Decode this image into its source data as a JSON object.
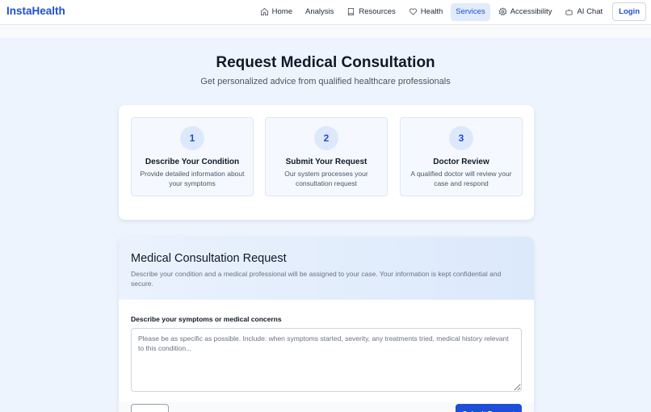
{
  "nav": {
    "brand": "InstaHealth",
    "items": [
      {
        "label": "Home",
        "icon": "home-icon"
      },
      {
        "label": "Analysis",
        "icon": ""
      },
      {
        "label": "Resources",
        "icon": "book-icon"
      },
      {
        "label": "Health",
        "icon": "heart-icon"
      },
      {
        "label": "Services",
        "icon": "",
        "active": true
      },
      {
        "label": "Accessibility",
        "icon": "settings-icon"
      },
      {
        "label": "AI Chat",
        "icon": "bot-icon"
      }
    ],
    "login": "Login"
  },
  "header": {
    "title": "Request Medical Consultation",
    "subtitle": "Get personalized advice from qualified healthcare professionals"
  },
  "steps": [
    {
      "number": "1",
      "title": "Describe Your Condition",
      "desc": "Provide detailed information about your symptoms"
    },
    {
      "number": "2",
      "title": "Submit Your Request",
      "desc": "Our system processes your consultation request"
    },
    {
      "number": "3",
      "title": "Doctor Review",
      "desc": "A qualified doctor will review your case and respond"
    }
  ],
  "form": {
    "title": "Medical Consultation Request",
    "description": "Describe your condition and a medical professional will be assigned to your case. Your information is kept confidential and secure.",
    "field_label": "Describe your symptoms or medical concerns",
    "placeholder": "Please be as specific as possible. Include: when symptoms started, severity, any treatments tried, medical history relevant to this condition...",
    "value": "",
    "cancel": "Cancel",
    "submit": "Submit Request"
  },
  "colors": {
    "accent": "#1d4ed8",
    "background": "#eef4fd"
  }
}
